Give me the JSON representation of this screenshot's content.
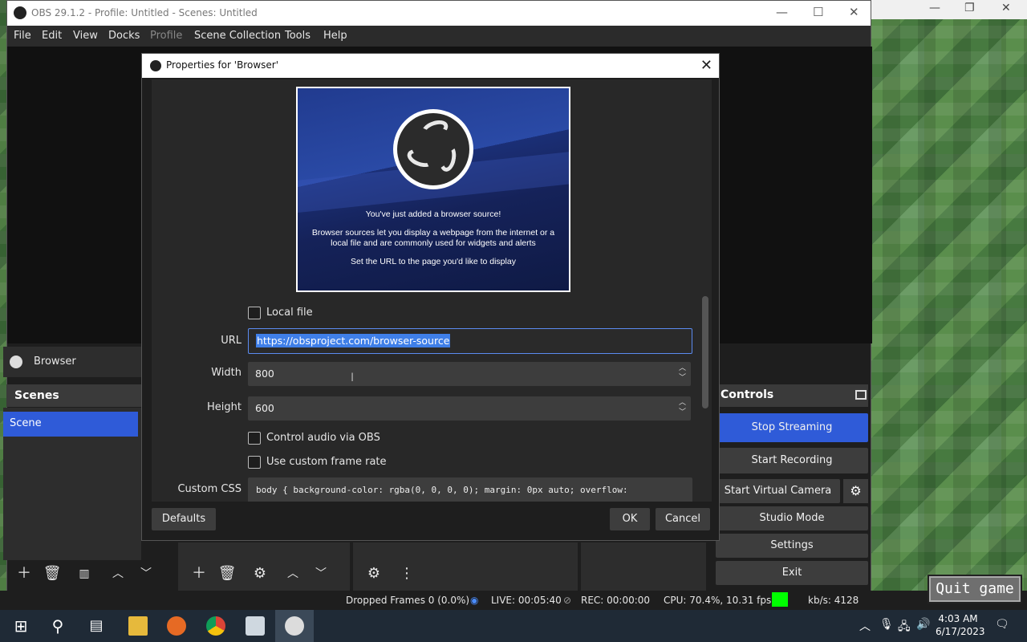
{
  "window": {
    "title": "OBS 29.1.2 - Profile: Untitled - Scenes: Untitled",
    "minimize": "—",
    "maximize": "☐",
    "close": "✕"
  },
  "outer_window": {
    "minimize": "—",
    "restore": "❐",
    "close": "✕"
  },
  "menu": [
    "File",
    "Edit",
    "View",
    "Docks",
    "Profile",
    "Scene Collection",
    "Tools",
    "Help"
  ],
  "sources_strip": {
    "label": "Browser"
  },
  "scenes": {
    "title": "Scenes",
    "items": [
      "Scene"
    ]
  },
  "controls": {
    "title": "Controls",
    "stop_streaming": "Stop Streaming",
    "start_recording": "Start Recording",
    "start_virtual_camera": "Start Virtual Camera",
    "studio_mode": "Studio Mode",
    "settings": "Settings",
    "exit": "Exit"
  },
  "status": {
    "dropped_frames": "Dropped Frames 0 (0.0%)",
    "live": "LIVE: 00:05:40",
    "rec": "REC: 00:00:00",
    "cpu": "CPU: 70.4%, 10.31 fps",
    "kbs": "kb/s: 4128",
    "indicator_color": "#00ff00"
  },
  "dialog": {
    "title": "Properties for 'Browser'",
    "close": "✕",
    "preview": {
      "line1": "You've just added a browser source!",
      "line2": "Browser sources let you display a webpage from the internet or a local file and are commonly used for widgets and alerts",
      "line3": "Set the URL to the page you'd like to display"
    },
    "local_file_label": "Local file",
    "url_label": "URL",
    "url_value": "https://obsproject.com/browser-source",
    "width_label": "Width",
    "width_value": "800",
    "height_label": "Height",
    "height_value": "600",
    "control_audio_label": "Control audio via OBS",
    "custom_frame_rate_label": "Use custom frame rate",
    "custom_css_label": "Custom CSS",
    "custom_css_value": "body { background-color: rgba(0, 0, 0, 0); margin: 0px auto; overflow:",
    "defaults_button": "Defaults",
    "ok_button": "OK",
    "cancel_button": "Cancel"
  },
  "game": {
    "quit_button": "Quit game"
  },
  "taskbar": {
    "time": "4:03 AM",
    "date": "6/17/2023"
  },
  "colors": {
    "accent": "#2f5bd8",
    "selection": "#3f7fe8",
    "url_border": "#5b8bf0"
  }
}
